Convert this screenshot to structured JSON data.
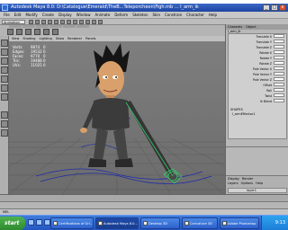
{
  "window": {
    "title": "Autodesk Maya 8.0: D:\\Catalogue\\Emerald\\TheB...Teleporcheon\\Figh.mb   ...   I_arm_ik",
    "buttons": [
      "_",
      "□",
      "x"
    ]
  },
  "menubar": [
    "File",
    "Edit",
    "Modify",
    "Create",
    "Display",
    "Window",
    "Animate",
    "Deform",
    "Skeleton",
    "Skin",
    "Constrain",
    "Character",
    "Help"
  ],
  "toolbar": {
    "mode": "Animation"
  },
  "panel_menu": [
    "View",
    "Shading",
    "Lighting",
    "Show",
    "Renderer",
    "Panels"
  ],
  "hud": [
    {
      "label": "Verts:",
      "v1": "9874",
      "v2": "0"
    },
    {
      "label": "Edges:",
      "v1": "19532",
      "v2": "0"
    },
    {
      "label": "Faces:",
      "v1": "9770",
      "v2": "0"
    },
    {
      "label": "Tris:",
      "v1": "19488",
      "v2": "0"
    },
    {
      "label": "UVs:",
      "v1": "11025",
      "v2": "0"
    }
  ],
  "channel_box": {
    "tabs": [
      "Channels",
      "Object"
    ],
    "object": "I_arm_ik",
    "attributes": [
      "Translate X",
      "Translate Y",
      "Translate Z",
      "Rotate X",
      "Rotate Y",
      "Rotate Z",
      "Pole Vector X",
      "Pole Vector Y",
      "Pole Vector Z",
      "Offset",
      "Roll",
      "Twist",
      "Ik Blend"
    ],
    "shapes_label": "SHAPES",
    "shape_name": "I_armEffector1"
  },
  "layer_editor": {
    "tabs": [
      "Display",
      "Render"
    ],
    "menu": [
      "Layers",
      "Options",
      "Help"
    ],
    "row_label": "layer1"
  },
  "command_line": "MEL",
  "taskbar": {
    "start_label": "start",
    "tasks": [
      {
        "label": "Certifications of Grl...",
        "active": false
      },
      {
        "label": "Autodesk Maya 8.0...",
        "active": true
      },
      {
        "label": "Desktop 3D",
        "active": false
      },
      {
        "label": "Caricature 3D",
        "active": false
      },
      {
        "label": "Adobe Photoshop",
        "active": false
      }
    ],
    "clock": "9:13"
  },
  "colors": {
    "viewport": "#747474",
    "grid": "#4a4a4a",
    "skin": "#d9a06b",
    "outfit": "#3b3b3b",
    "ik_handle": "#2fd06a",
    "selection_curve": "#1e2aa8",
    "taskbar": "#2457c0"
  }
}
